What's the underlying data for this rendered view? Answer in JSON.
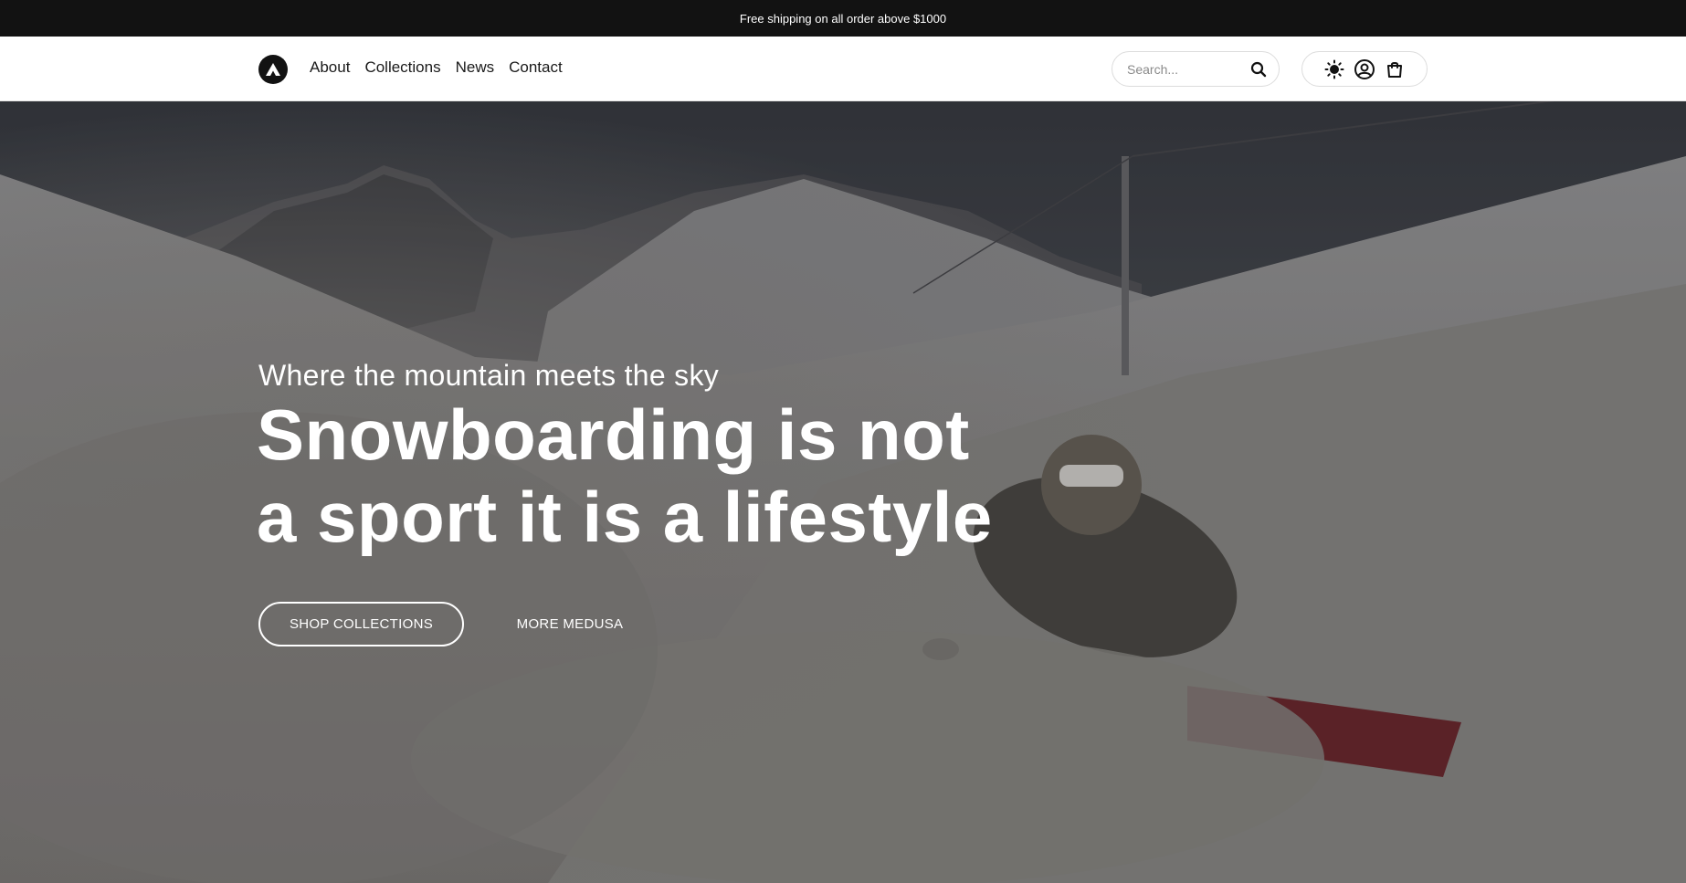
{
  "announcement": {
    "text": "Free shipping on all order above $1000"
  },
  "header": {
    "nav": [
      {
        "label": "About"
      },
      {
        "label": "Collections"
      },
      {
        "label": "News"
      },
      {
        "label": "Contact"
      }
    ],
    "search": {
      "placeholder": "Search..."
    },
    "icons": [
      "logo-icon",
      "search-icon",
      "sun-icon",
      "account-icon",
      "bag-icon"
    ]
  },
  "hero": {
    "tagline": "Where the mountain meets the sky",
    "headline_line1": "Snowboarding is not",
    "headline_line2": "a sport it is a lifestyle",
    "primary_button": "SHOP COLLECTIONS",
    "secondary_button": "MORE MEDUSA"
  },
  "colors": {
    "announcement_bg": "#121212",
    "header_bg": "#ffffff",
    "text_dark": "#1a1a1a",
    "hero_text": "#ffffff"
  }
}
